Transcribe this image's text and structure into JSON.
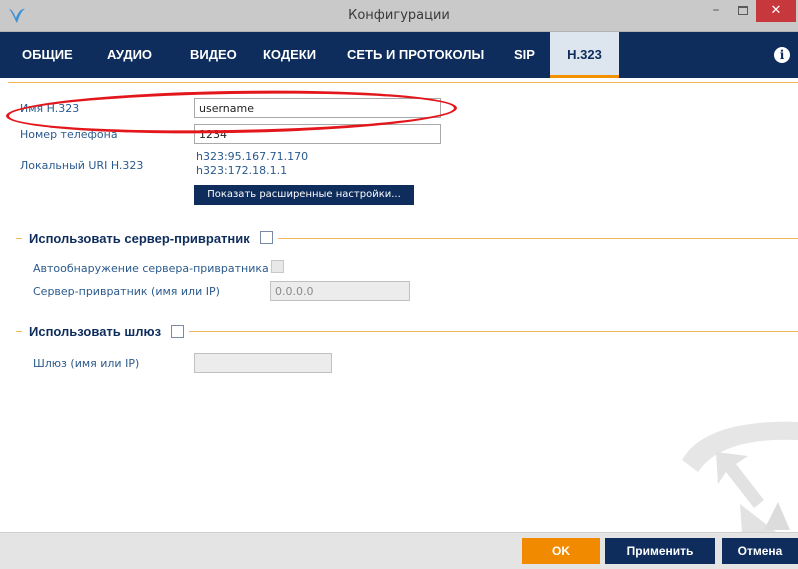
{
  "window": {
    "title": "Конфигурации",
    "minimize_glyph": "–",
    "close_glyph": "✕",
    "app_icon": "app-logo-icon"
  },
  "tabs": [
    {
      "label": "ОБЩИЕ"
    },
    {
      "label": "АУДИО"
    },
    {
      "label": "ВИДЕО"
    },
    {
      "label": "КОДЕКИ"
    },
    {
      "label": "СЕТЬ И ПРОТОКОЛЫ"
    },
    {
      "label": "SIP"
    },
    {
      "label": "H.323",
      "active": true
    }
  ],
  "info_glyph": "i",
  "form": {
    "h323_name_label": "Имя H.323",
    "h323_name_value": "username",
    "phone_label": "Номер телефона",
    "phone_value": "1234",
    "local_uri_label": "Локальный URI H.323",
    "local_uris": [
      "h323:95.167.71.170",
      "h323:172.18.1.1"
    ],
    "advanced_button": "Показать расширенные настройки..."
  },
  "gatekeeper": {
    "section_title": "Использовать сервер-привратник",
    "enabled": false,
    "autodetect_label": "Автообнаружение сервера-привратника",
    "autodetect_checked": false,
    "server_label": "Сервер-привратник (имя или IP)",
    "server_value": "0.0.0.0"
  },
  "gateway": {
    "section_title": "Использовать шлюз",
    "enabled": false,
    "gateway_label": "Шлюз (имя или IP)",
    "gateway_value": ""
  },
  "footer": {
    "ok": "OK",
    "apply": "Применить",
    "cancel": "Отмена"
  },
  "colors": {
    "brand_navy": "#0e2d5c",
    "accent_orange": "#f28a00",
    "annotation_red": "#e3161b",
    "close_red": "#c7383c"
  }
}
